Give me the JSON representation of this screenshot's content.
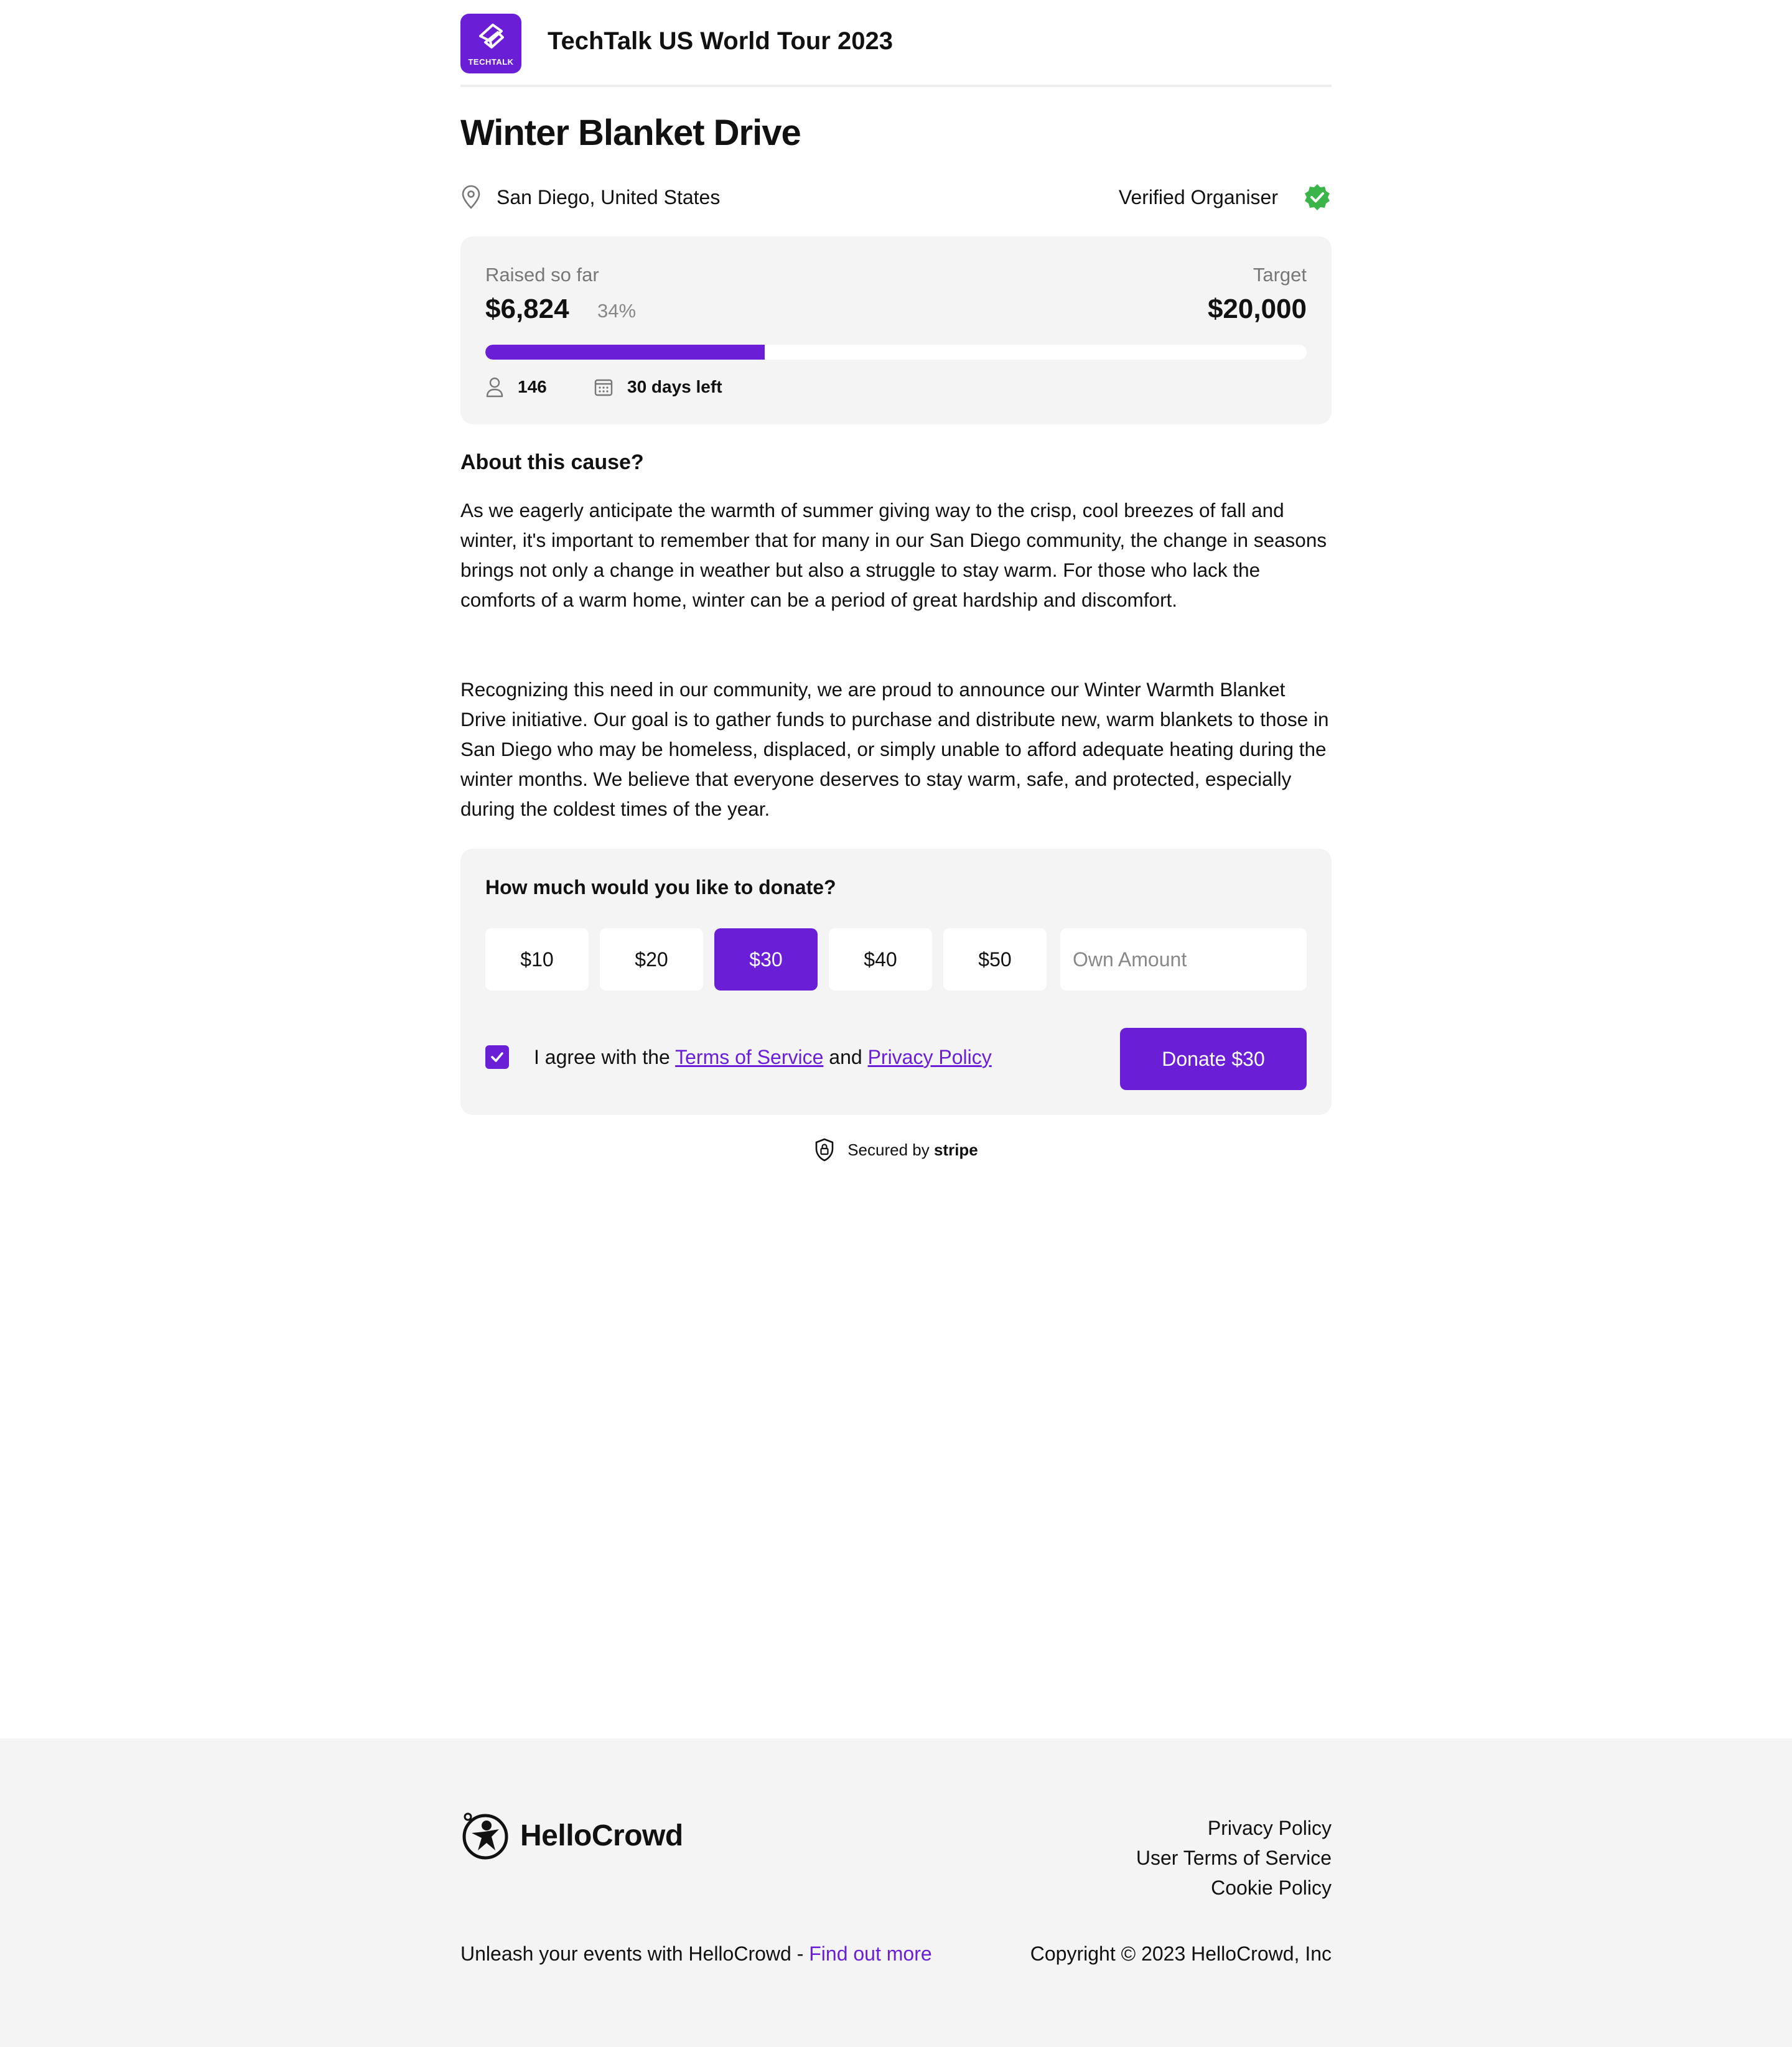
{
  "header": {
    "logo_text": "TECHTALK",
    "event_title": "TechTalk US World Tour 2023"
  },
  "campaign": {
    "title": "Winter Blanket Drive",
    "location": "San Diego, United States",
    "verified_label": "Verified Organiser"
  },
  "progress": {
    "raised_label": "Raised so far",
    "raised_amount": "$6,824",
    "percent_label": "34%",
    "percent_value": 34,
    "target_label": "Target",
    "target_amount": "$20,000",
    "supporters": "146",
    "days_left": "30 days left"
  },
  "about": {
    "heading": "About this cause?",
    "paragraph_1": "As we eagerly anticipate the warmth of summer giving way to the crisp, cool breezes of fall and winter, it's important to remember that for many in our San Diego community, the change in seasons brings not only a change in weather but also a struggle to stay warm. For those who lack the comforts of a warm home, winter can be a period of great hardship and discomfort.",
    "paragraph_2": "Recognizing this need in our community, we are proud to announce our Winter Warmth Blanket Drive initiative. Our goal is to gather funds to purchase and distribute new, warm blankets to those in San Diego who may be homeless, displaced, or simply unable to afford adequate heating during the winter months. We believe that everyone deserves to stay warm, safe, and protected, especially during the coldest times of the year."
  },
  "donation": {
    "question": "How much would you like to donate?",
    "amounts": [
      "$10",
      "$20",
      "$30",
      "$40",
      "$50"
    ],
    "selected_amount": "$30",
    "own_amount_placeholder": "Own Amount",
    "agree_prefix": "I agree with the",
    "terms_link": "Terms of Service",
    "agree_and": "and",
    "privacy_link": "Privacy Policy",
    "agreed": true,
    "donate_button": "Donate $30"
  },
  "secured": {
    "prefix": "Secured by",
    "provider": "stripe"
  },
  "footer": {
    "brand": "HelloCrowd",
    "links": [
      "Privacy Policy",
      "User Terms of Service",
      "Cookie Policy"
    ],
    "tagline_prefix": "Unleash your events with HelloCrowd -",
    "tagline_link": "Find out more",
    "copyright": "Copyright © 2023 HelloCrowd, Inc"
  },
  "colors": {
    "accent": "#6a1fd6",
    "verified_green": "#3bb54a",
    "card_background": "#f4f4f4"
  },
  "icons": [
    "techtalk-logo-icon",
    "location-pin-icon",
    "verified-badge-icon",
    "person-icon",
    "calendar-icon",
    "checkmark-icon",
    "shield-lock-icon",
    "hellocrowd-logo-icon"
  ]
}
